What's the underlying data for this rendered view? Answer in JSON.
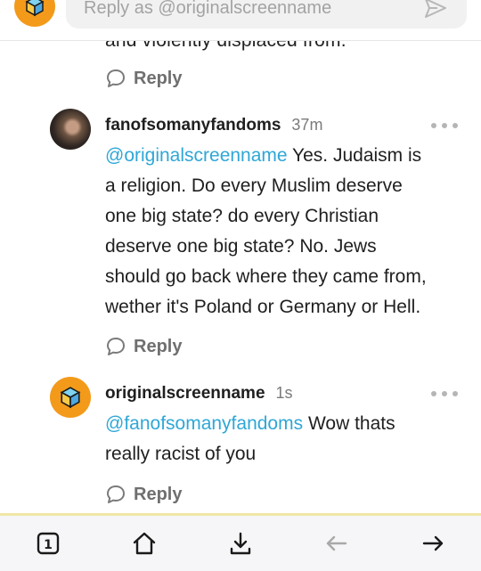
{
  "reply_bar": {
    "placeholder": "Reply as @originalscreenname",
    "avatar_icon": "cube-icon",
    "send_icon": "send-icon"
  },
  "cutoff_text": "and violently displaced from.",
  "first_reply_label": "Reply",
  "comments": [
    {
      "username": "fanofsomanyfandoms",
      "time": "37m",
      "mention": "@originalscreenname",
      "lines": [
        " Yes. Judaism is",
        "a religion. Do every Muslim deserve",
        "one big state? do every Christian",
        "deserve one big state? No. Jews",
        "should go back where they came from,",
        "wether it's Poland or Germany or Hell."
      ],
      "reply_label": "Reply"
    },
    {
      "username": "originalscreenname",
      "time": "1s",
      "mention": "@fanofsomanyfandoms",
      "lines": [
        " Wow thats",
        "really racist of you"
      ],
      "reply_label": "Reply"
    }
  ],
  "bottom_nav": {
    "tabs_count": "1",
    "items": [
      "tabs-icon",
      "home-icon",
      "download-icon",
      "back-arrow-icon",
      "forward-arrow-icon"
    ]
  },
  "colors": {
    "accent_orange": "#f39a1b",
    "mention_blue": "#2fa7d6",
    "muted_gray": "#6f6f6f"
  }
}
